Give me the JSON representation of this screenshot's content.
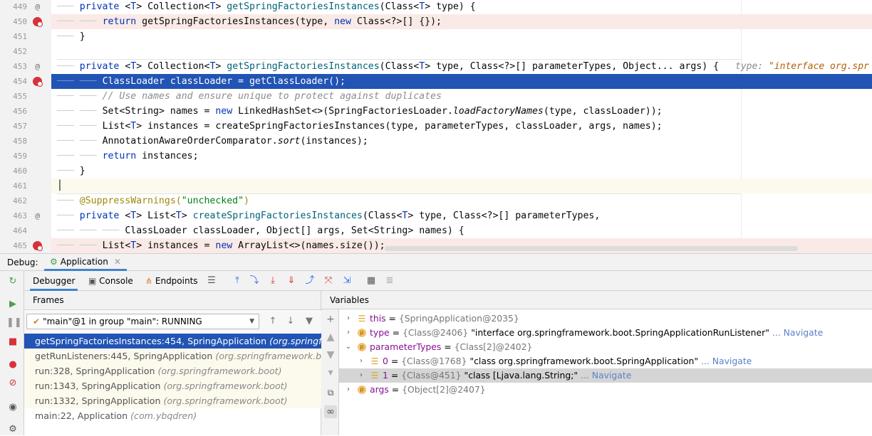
{
  "editor": {
    "lines": [
      {
        "num": "449",
        "icon": "@",
        "kind": "normal",
        "indent": 1,
        "tokens": [
          [
            "kw",
            "private "
          ],
          [
            "",
            "<"
          ],
          [
            "kw",
            "T"
          ],
          [
            "",
            "> Collection<"
          ],
          [
            "kw",
            "T"
          ],
          [
            "",
            "> "
          ],
          [
            "fn",
            "getSpringFactoriesInstances"
          ],
          [
            "",
            "(Class<"
          ],
          [
            "kw",
            "T"
          ],
          [
            "",
            "> type) {"
          ]
        ]
      },
      {
        "num": "450",
        "icon": "bp",
        "kind": "bpline",
        "indent": 2,
        "tokens": [
          [
            "kw",
            "return "
          ],
          [
            "",
            "getSpringFactoriesInstances(type, "
          ],
          [
            "kw",
            "new "
          ],
          [
            "",
            "Class<?>[] {});"
          ]
        ]
      },
      {
        "num": "451",
        "icon": "",
        "kind": "normal",
        "indent": 1,
        "tokens": [
          [
            "",
            "}"
          ]
        ]
      },
      {
        "num": "452",
        "icon": "",
        "kind": "normal",
        "indent": 0,
        "tokens": []
      },
      {
        "num": "453",
        "icon": "@",
        "kind": "normal",
        "indent": 1,
        "tokens": [
          [
            "kw",
            "private "
          ],
          [
            "",
            "<"
          ],
          [
            "kw",
            "T"
          ],
          [
            "",
            "> Collection<"
          ],
          [
            "kw",
            "T"
          ],
          [
            "",
            "> "
          ],
          [
            "fn",
            "getSpringFactoriesInstances"
          ],
          [
            "",
            "(Class<"
          ],
          [
            "kw",
            "T"
          ],
          [
            "",
            "> type, Class<?>[] parameterTypes, Object... args) {"
          ]
        ]
      },
      {
        "num": "454",
        "icon": "bp",
        "kind": "exec",
        "indent": 2,
        "tokens": [
          [
            "",
            "ClassLoader classLoader = getClassLoader();"
          ]
        ]
      },
      {
        "num": "455",
        "icon": "",
        "kind": "normal",
        "indent": 2,
        "tokens": [
          [
            "cm",
            "// Use names and ensure unique to protect against duplicates"
          ]
        ]
      },
      {
        "num": "456",
        "icon": "",
        "kind": "normal",
        "indent": 2,
        "tokens": [
          [
            "",
            "Set<String> names = "
          ],
          [
            "kw",
            "new "
          ],
          [
            "",
            "LinkedHashSet<>(SpringFactoriesLoader."
          ],
          [
            "it",
            "loadFactoryNames"
          ],
          [
            "",
            "(type, classLoader));"
          ]
        ]
      },
      {
        "num": "457",
        "icon": "",
        "kind": "normal",
        "indent": 2,
        "tokens": [
          [
            "",
            "List<"
          ],
          [
            "kw",
            "T"
          ],
          [
            "",
            "> instances = createSpringFactoriesInstances(type, parameterTypes, classLoader, args, names);"
          ]
        ]
      },
      {
        "num": "458",
        "icon": "",
        "kind": "normal",
        "indent": 2,
        "tokens": [
          [
            "",
            "AnnotationAwareOrderComparator."
          ],
          [
            "it",
            "sort"
          ],
          [
            "",
            "(instances);"
          ]
        ]
      },
      {
        "num": "459",
        "icon": "",
        "kind": "normal",
        "indent": 2,
        "tokens": [
          [
            "kw",
            "return "
          ],
          [
            "",
            "instances;"
          ]
        ]
      },
      {
        "num": "460",
        "icon": "",
        "kind": "normal",
        "indent": 1,
        "tokens": [
          [
            "",
            "}"
          ]
        ]
      },
      {
        "num": "461",
        "icon": "",
        "kind": "curline",
        "indent": 0,
        "tokens": []
      },
      {
        "num": "462",
        "icon": "",
        "kind": "normal",
        "indent": 1,
        "tokens": [
          [
            "an",
            "@SuppressWarnings("
          ],
          [
            "st",
            "\"unchecked\""
          ],
          [
            "an",
            ")"
          ]
        ]
      },
      {
        "num": "463",
        "icon": "@",
        "kind": "normal",
        "indent": 1,
        "tokens": [
          [
            "kw",
            "private "
          ],
          [
            "",
            "<"
          ],
          [
            "kw",
            "T"
          ],
          [
            "",
            "> List<"
          ],
          [
            "kw",
            "T"
          ],
          [
            "",
            "> "
          ],
          [
            "fn",
            "createSpringFactoriesInstances"
          ],
          [
            "",
            "(Class<"
          ],
          [
            "kw",
            "T"
          ],
          [
            "",
            "> type, Class<?>[] parameterTypes,"
          ]
        ]
      },
      {
        "num": "464",
        "icon": "",
        "kind": "normal",
        "indent": 3,
        "tokens": [
          [
            "",
            "ClassLoader classLoader, Object[] args, Set<String> names) {"
          ]
        ]
      },
      {
        "num": "465",
        "icon": "bp",
        "kind": "bpline",
        "indent": 2,
        "tokens": [
          [
            "",
            "List<"
          ],
          [
            "kw",
            "T"
          ],
          [
            "",
            "> instances = "
          ],
          [
            "kw",
            "new "
          ],
          [
            "",
            "ArrayList<>(names.size());"
          ]
        ]
      }
    ],
    "inline_hint": {
      "label": "type: ",
      "value": "\"interface org.spr"
    }
  },
  "debug": {
    "label": "Debug:",
    "app_tab": "Application",
    "tabs": [
      "Debugger",
      "Console",
      "Endpoints"
    ],
    "frames_header": "Frames",
    "variables_header": "Variables",
    "thread": "\"main\"@1 in group \"main\": RUNNING",
    "frames": [
      {
        "method": "getSpringFactoriesInstances:454, SpringApplication ",
        "pkg": "(org.springframework.boot)",
        "state": "sel"
      },
      {
        "method": "getRunListeners:445, SpringApplication ",
        "pkg": "(org.springframework.boot)",
        "state": "lib"
      },
      {
        "method": "run:328, SpringApplication ",
        "pkg": "(org.springframework.boot)",
        "state": "lib"
      },
      {
        "method": "run:1343, SpringApplication ",
        "pkg": "(org.springframework.boot)",
        "state": "lib"
      },
      {
        "method": "run:1332, SpringApplication ",
        "pkg": "(org.springframework.boot)",
        "state": "lib"
      },
      {
        "method": "main:22, Application ",
        "pkg": "(com.ybqdren)",
        "state": ""
      }
    ],
    "variables": [
      {
        "depth": 0,
        "arrow": "›",
        "icon": "bars",
        "name": "this",
        "eq": " = ",
        "type": "{SpringApplication@2035}",
        "value": "",
        "nav": "",
        "sel": false
      },
      {
        "depth": 0,
        "arrow": "›",
        "icon": "p",
        "name": "type",
        "eq": " = ",
        "type": "{Class@2406} ",
        "value": "\"interface org.springframework.boot.SpringApplicationRunListener\"",
        "nav": " ... Navigate",
        "sel": false
      },
      {
        "depth": 0,
        "arrow": "⌄",
        "icon": "p",
        "name": "parameterTypes",
        "eq": " = ",
        "type": "{Class[2]@2402}",
        "value": "",
        "nav": "",
        "sel": false
      },
      {
        "depth": 1,
        "arrow": "›",
        "icon": "bars",
        "name": "0",
        "eq": " = ",
        "type": "{Class@1768} ",
        "value": "\"class org.springframework.boot.SpringApplication\"",
        "nav": " ... Navigate",
        "sel": false
      },
      {
        "depth": 1,
        "arrow": "›",
        "icon": "bars",
        "name": "1",
        "eq": " = ",
        "type": "{Class@451} ",
        "value": "\"class [Ljava.lang.String;\"",
        "nav": " ... Navigate",
        "sel": true
      },
      {
        "depth": 0,
        "arrow": "›",
        "icon": "p",
        "name": "args",
        "eq": " = ",
        "type": "{Object[2]@2407}",
        "value": "",
        "nav": "",
        "sel": false
      }
    ]
  }
}
